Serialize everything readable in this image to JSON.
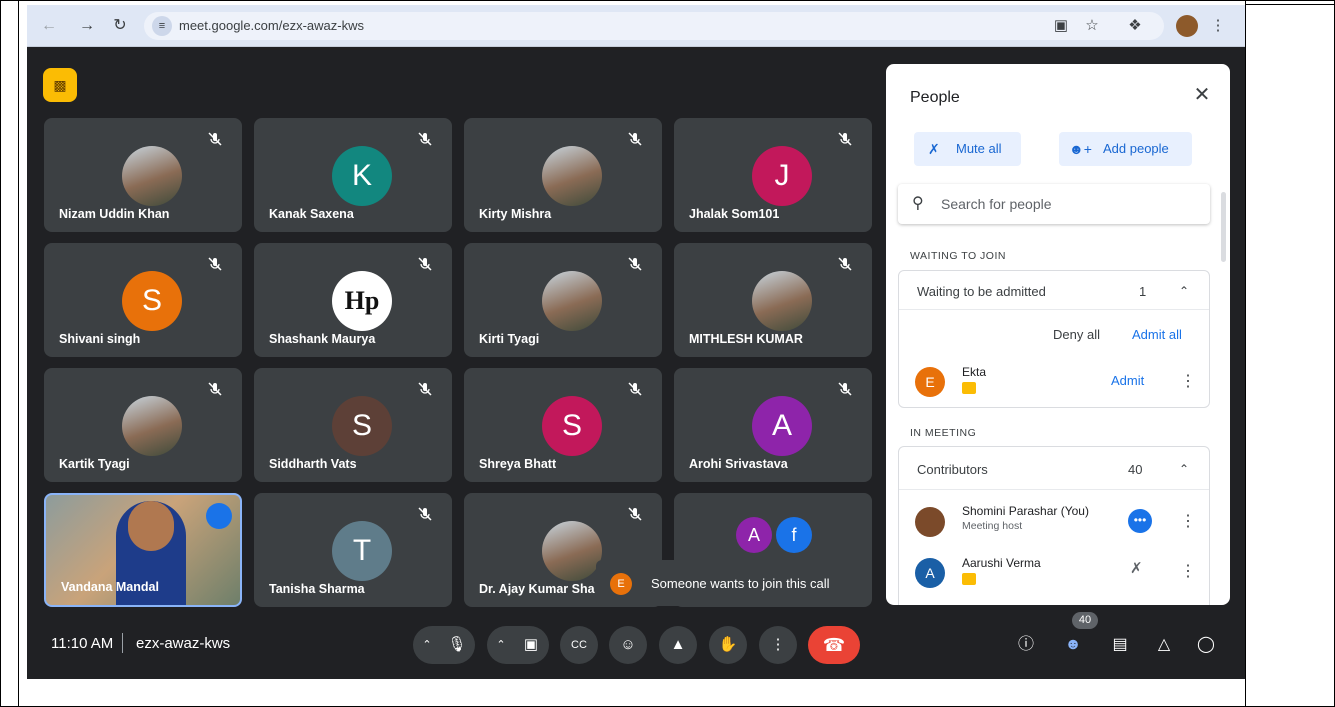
{
  "browser": {
    "url": "meet.google.com/ezx-awaz-kws"
  },
  "tiles": [
    {
      "name": "Nizam Uddin Khan",
      "type": "photo"
    },
    {
      "name": "Kanak Saxena",
      "initial": "K",
      "color": "#12877f"
    },
    {
      "name": "Kirty Mishra",
      "type": "photo"
    },
    {
      "name": "Jhalak Som101",
      "initial": "J",
      "color": "#c2185b"
    },
    {
      "name": "Shivani singh",
      "initial": "S",
      "color": "#e8710a"
    },
    {
      "name": "Shashank Maurya",
      "type": "logo",
      "logo_text": "Hp"
    },
    {
      "name": "Kirti Tyagi",
      "type": "photo"
    },
    {
      "name": "MITHLESH KUMAR",
      "type": "photo"
    },
    {
      "name": "Kartik Tyagi",
      "type": "photo"
    },
    {
      "name": "Siddharth Vats",
      "initial": "S",
      "color": "#5d4037"
    },
    {
      "name": "Shreya Bhatt",
      "initial": "S",
      "color": "#c2185b"
    },
    {
      "name": "Arohi Srivastava",
      "initial": "A",
      "color": "#8e24aa"
    },
    {
      "name": "Vandana Mandal",
      "type": "video"
    },
    {
      "name": "Tanisha Sharma",
      "initial": "T",
      "color": "#5f7c8a"
    },
    {
      "name": "Dr. Ajay Kumar Sha",
      "type": "photo"
    },
    {
      "name": "",
      "type": "group",
      "initials": [
        "A",
        "f"
      ]
    }
  ],
  "toast": {
    "initial": "E",
    "text": "Someone wants to join this call"
  },
  "bottom": {
    "time": "11:10 AM",
    "meeting_code": "ezx-awaz-kws",
    "people_count": "40"
  },
  "panel": {
    "title": "People",
    "mute_all": "Mute all",
    "add_people": "Add people",
    "search_placeholder": "Search for people",
    "waiting_section": "WAITING TO JOIN",
    "waiting_label": "Waiting to be admitted",
    "waiting_count": "1",
    "deny_all": "Deny all",
    "admit_all": "Admit all",
    "waiting_person": {
      "initial": "E",
      "name": "Ekta",
      "admit": "Admit"
    },
    "meeting_section": "IN MEETING",
    "contributors_label": "Contributors",
    "contributors_count": "40",
    "people": [
      {
        "name": "Shomini Parashar (You)",
        "sub": "Meeting host"
      },
      {
        "initial": "A",
        "name": "Aarushi Verma"
      }
    ]
  },
  "colors": {
    "accent": "#1a73e8",
    "end_call": "#ea4335",
    "brand_yellow": "#fbbc04"
  }
}
